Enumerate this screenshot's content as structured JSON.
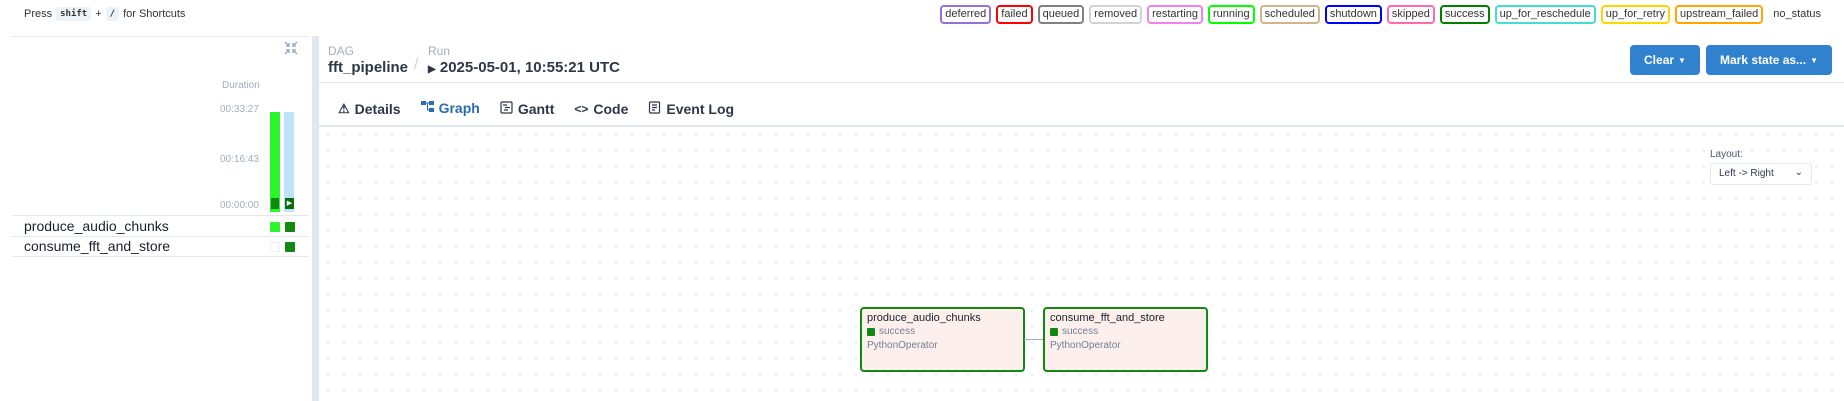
{
  "shortcuts": {
    "prefix": "Press",
    "key1": "shift",
    "plus": "+",
    "key2": "/",
    "suffix": "for Shortcuts"
  },
  "legend": [
    {
      "label": "deferred",
      "color": "#9370db"
    },
    {
      "label": "failed",
      "color": "#ff0000"
    },
    {
      "label": "queued",
      "color": "#808080"
    },
    {
      "label": "removed",
      "color": "#d3d3d3"
    },
    {
      "label": "restarting",
      "color": "#ee82ee"
    },
    {
      "label": "running",
      "color": "#00ff00"
    },
    {
      "label": "scheduled",
      "color": "#d2b48c"
    },
    {
      "label": "shutdown",
      "color": "#0000ff"
    },
    {
      "label": "skipped",
      "color": "#ff69b4"
    },
    {
      "label": "success",
      "color": "#008000"
    },
    {
      "label": "up_for_reschedule",
      "color": "#40e0d0"
    },
    {
      "label": "up_for_retry",
      "color": "#ffd700"
    },
    {
      "label": "upstream_failed",
      "color": "#ffa500"
    },
    {
      "label": "no_status",
      "color": "transparent"
    }
  ],
  "grid": {
    "duration_label": "Duration",
    "ticks": [
      "00:33:27",
      "00:16:43",
      "00:00:00"
    ],
    "tasks": [
      "produce_audio_chunks",
      "consume_fft_and_store"
    ]
  },
  "header": {
    "dag_label": "DAG",
    "dag_id": "fft_pipeline",
    "run_label": "Run",
    "run_id": "2025-05-01, 10:55:21 UTC",
    "clear_button": "Clear",
    "mark_button": "Mark state as..."
  },
  "tabs": {
    "details": "Details",
    "graph": "Graph",
    "gantt": "Gantt",
    "code": "Code",
    "event_log": "Event Log"
  },
  "layout": {
    "label": "Layout:",
    "value": "Left -> Right"
  },
  "nodes": [
    {
      "title": "produce_audio_chunks",
      "state": "success",
      "operator": "PythonOperator"
    },
    {
      "title": "consume_fft_and_store",
      "state": "success",
      "operator": "PythonOperator"
    }
  ]
}
